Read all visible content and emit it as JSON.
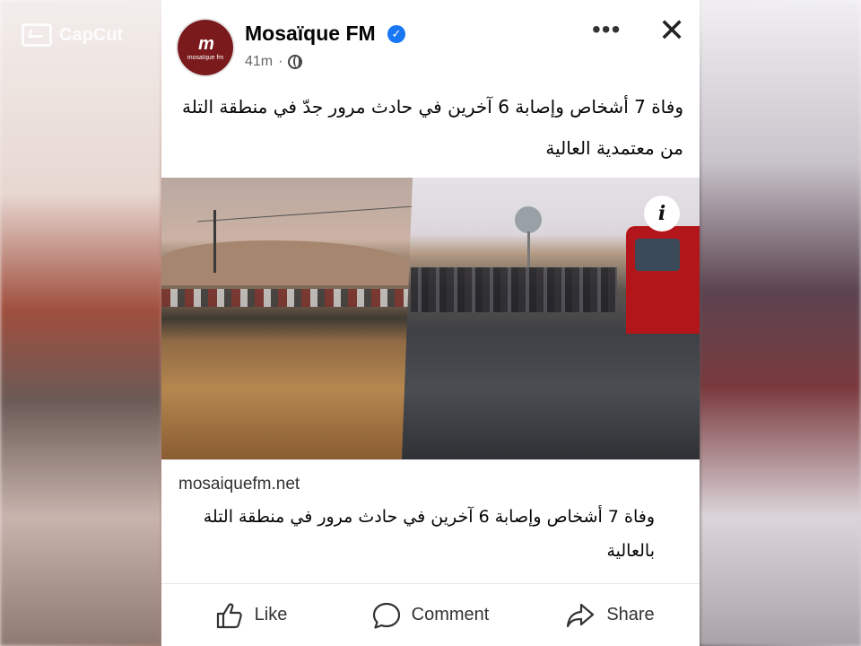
{
  "watermark": {
    "label": "CapCut"
  },
  "post": {
    "page_name": "Mosaïque FM",
    "avatar_text": "m",
    "avatar_subtext": "mosaïque fm",
    "time": "41m",
    "separator": "·",
    "text": "وفاة 7 أشخاص وإصابة 6 آخرين في حادث مرور جدّ في منطقة التلة من معتمدية العالية"
  },
  "media": {
    "info_label": "i"
  },
  "link_preview": {
    "domain": "mosaiquefm.net",
    "title": "وفاة 7 أشخاص وإصابة 6 آخرين في حادث مرور في منطقة التلة بالعالية"
  },
  "actions": {
    "like": "Like",
    "comment": "Comment",
    "share": "Share"
  },
  "colors": {
    "verified": "#1877f2",
    "avatar_bg": "#7b1a1c"
  }
}
